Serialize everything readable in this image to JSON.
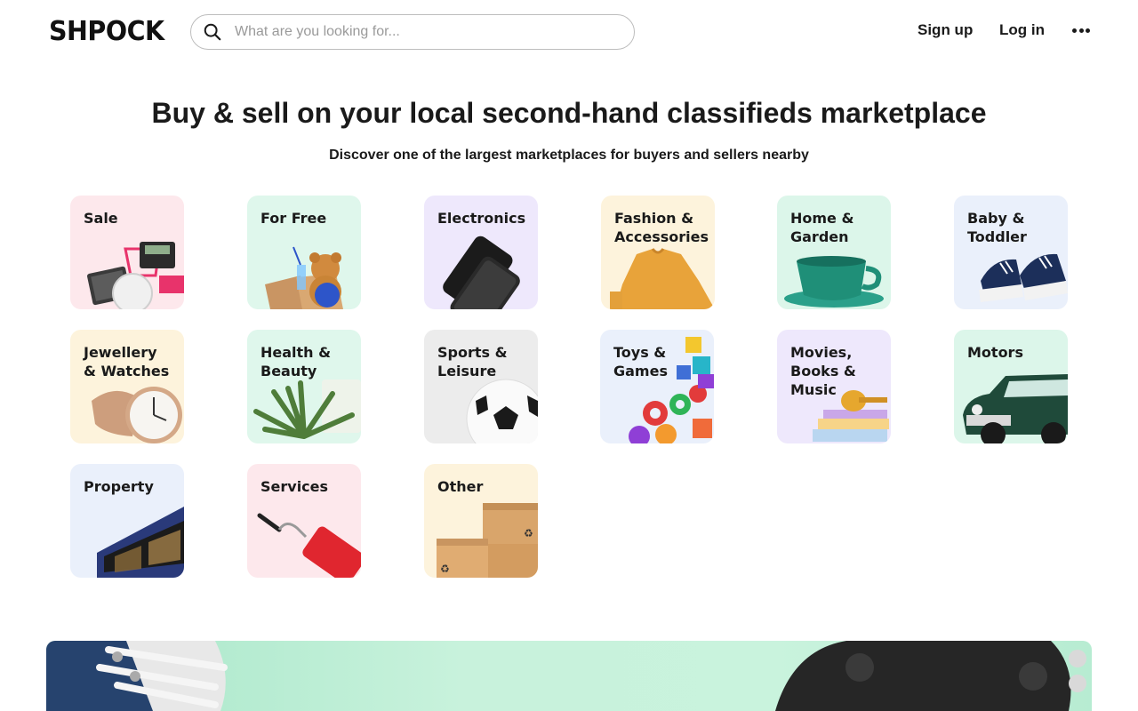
{
  "header": {
    "logo": "SHPOCK",
    "search_placeholder": "What are you looking for...",
    "signup": "Sign up",
    "login": "Log in",
    "more_icon": "more-horizontal-icon"
  },
  "hero": {
    "title": "Buy & sell on your local second-hand classifieds marketplace",
    "subtitle": "Discover one of the largest marketplaces for buyers and sellers nearby"
  },
  "categories": [
    {
      "label": "Sale",
      "bg": "#fde8ec"
    },
    {
      "label": "For Free",
      "bg": "#dff7ec"
    },
    {
      "label": "Electronics",
      "bg": "#eee8fc"
    },
    {
      "label": "Fashion &\nAccessories",
      "bg": "#fdf3dc"
    },
    {
      "label": "Home &\nGarden",
      "bg": "#dcf6ea"
    },
    {
      "label": "Baby &\nToddler",
      "bg": "#eaf0fb"
    },
    {
      "label": "Jewellery\n& Watches",
      "bg": "#fdf3dc"
    },
    {
      "label": "Health &\nBeauty",
      "bg": "#dff7ec"
    },
    {
      "label": "Sports &\nLeisure",
      "bg": "#ececec"
    },
    {
      "label": "Toys &\nGames",
      "bg": "#eaf0fb"
    },
    {
      "label": "Movies,\nBooks &\nMusic",
      "bg": "#eee8fc"
    },
    {
      "label": "Motors",
      "bg": "#dcf6ea"
    },
    {
      "label": "Property",
      "bg": "#eaf0fb"
    },
    {
      "label": "Services",
      "bg": "#fde8ec"
    },
    {
      "label": "Other",
      "bg": "#fdf3dc"
    }
  ],
  "colors": {
    "text": "#1a1a1a",
    "banner": "#c8f2dc"
  }
}
